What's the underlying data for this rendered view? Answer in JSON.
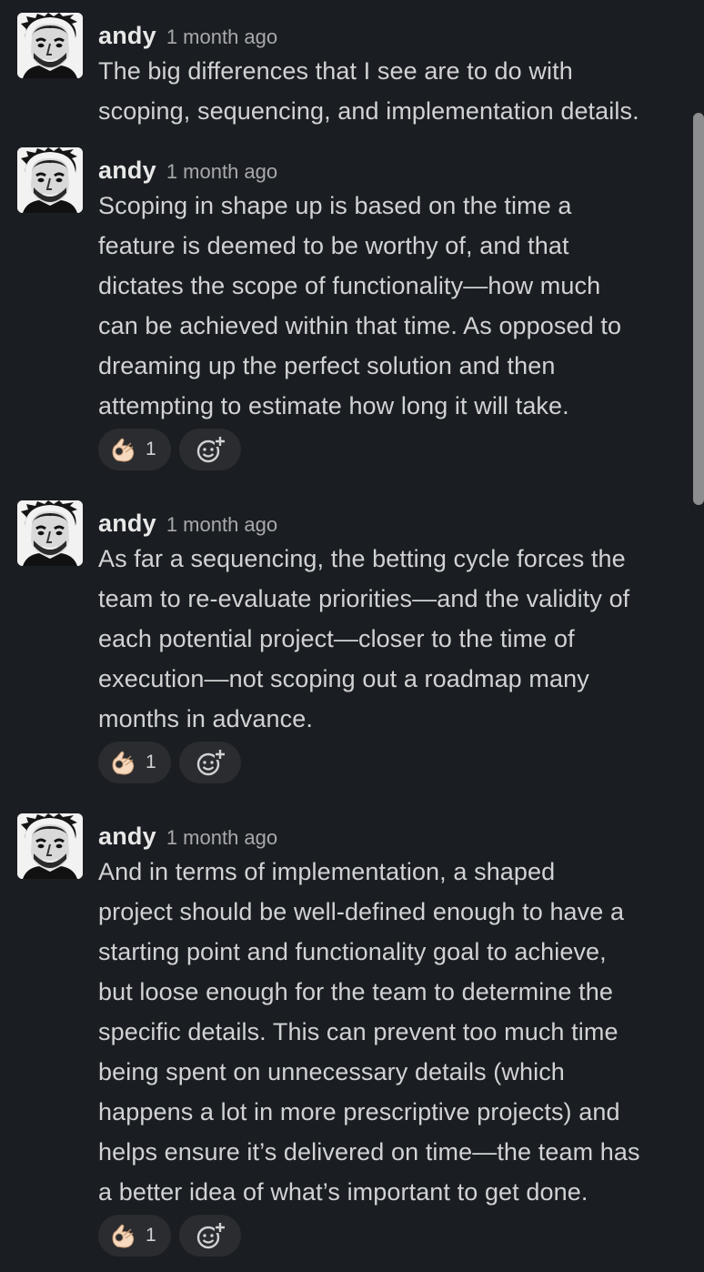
{
  "thread": {
    "messages": [
      {
        "author": "andy",
        "time": "1 month ago",
        "text": "The big differences that I see are to do with\nscoping, sequencing, and implementation details."
      },
      {
        "author": "andy",
        "time": "1 month ago",
        "text": "Scoping in shape up is based on the time a\nfeature is deemed to be worthy of, and that\ndictates the scope of functionality—how much\ncan be achieved within that time. As opposed to\ndreaming up the perfect solution and then\nattempting to estimate how long it will take.",
        "reaction": {
          "emoji": "ok-hand-emoji",
          "count": "1"
        }
      },
      {
        "author": "andy",
        "time": "1 month ago",
        "text": "As far a sequencing, the betting cycle forces the\nteam to re-evaluate priorities—and the validity of\neach potential project—closer to the time of\nexecution—not scoping out a roadmap many\nmonths in advance.",
        "reaction": {
          "emoji": "ok-hand-emoji",
          "count": "1"
        }
      },
      {
        "author": "andy",
        "time": "1 month ago",
        "text": "And in terms of implementation, a shaped\nproject should be well-defined enough to have a\nstarting point and functionality goal to achieve,\nbut loose enough for the team to determine the\nspecific details. This can prevent too much time\nbeing spent on unnecessary details (which\nhappens a lot in more prescriptive projects) and\nhelps ensure it’s delivered on time—the team has\na better idea of what’s important to get done.",
        "reaction": {
          "emoji": "ok-hand-emoji",
          "count": "1"
        }
      }
    ]
  },
  "icons": {
    "reaction": "ok-hand-emoji",
    "add_reaction": "add-reaction-icon"
  },
  "colors": {
    "background": "#1a1d21",
    "text": "#d1d2d3",
    "author": "#e8e8e8",
    "timestamp": "#a8a9ab",
    "pill": "#2a2c30",
    "scrollbar": "#8d8e90"
  }
}
